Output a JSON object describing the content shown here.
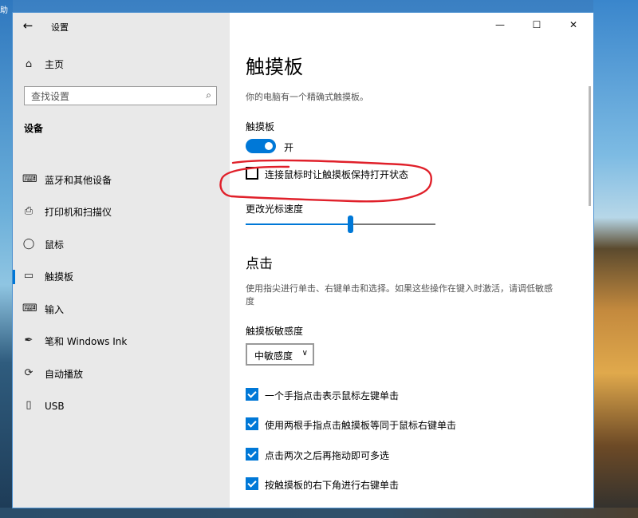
{
  "desktop": {
    "clipped_text": "助"
  },
  "window": {
    "title": "设置",
    "controls": {
      "minimize": "—",
      "maximize": "☐",
      "close": "✕"
    }
  },
  "sidebar": {
    "home_label": "主页",
    "search_placeholder": "查找设置",
    "section_label": "设备",
    "items": [
      {
        "label": "蓝牙和其他设备",
        "icon": "bluetooth-devices-icon",
        "glyph": "⌨",
        "selected": false
      },
      {
        "label": "打印机和扫描仪",
        "icon": "printer-icon",
        "glyph": "⎙",
        "selected": false
      },
      {
        "label": "鼠标",
        "icon": "mouse-icon",
        "glyph": "◯",
        "selected": false
      },
      {
        "label": "触摸板",
        "icon": "touchpad-icon",
        "glyph": "▭",
        "selected": true
      },
      {
        "label": "输入",
        "icon": "keyboard-icon",
        "glyph": "⌨",
        "selected": false
      },
      {
        "label": "笔和 Windows Ink",
        "icon": "pen-icon",
        "glyph": "✒",
        "selected": false
      },
      {
        "label": "自动播放",
        "icon": "autoplay-icon",
        "glyph": "⟳",
        "selected": false
      },
      {
        "label": "USB",
        "icon": "usb-icon",
        "glyph": "▯",
        "selected": false
      }
    ]
  },
  "main": {
    "title": "触摸板",
    "description": "你的电脑有一个精确式触摸板。",
    "touchpad_label": "触摸板",
    "toggle": {
      "on": true,
      "label": "开"
    },
    "keep_on_with_mouse": {
      "label": "连接鼠标时让触摸板保持打开状态",
      "checked": false
    },
    "cursor_speed": {
      "label": "更改光标速度",
      "level_percent": 55
    },
    "taps": {
      "title": "点击",
      "description": "使用指尖进行单击、右键单击和选择。如果这些操作在键入时激活，请调低敏感度",
      "sensitivity_label": "触摸板敏感度",
      "sensitivity_value": "中敏感度",
      "options": [
        {
          "label": "一个手指点击表示鼠标左键单击",
          "checked": true
        },
        {
          "label": "使用两根手指点击触摸板等同于鼠标右键单击",
          "checked": true
        },
        {
          "label": "点击两次之后再拖动即可多选",
          "checked": true
        },
        {
          "label": "按触摸板的右下角进行右键单击",
          "checked": true
        }
      ]
    },
    "annotation_color": "#e0202a"
  },
  "colors": {
    "accent": "#0078d7",
    "sidebar_bg": "#e9e9e9"
  }
}
